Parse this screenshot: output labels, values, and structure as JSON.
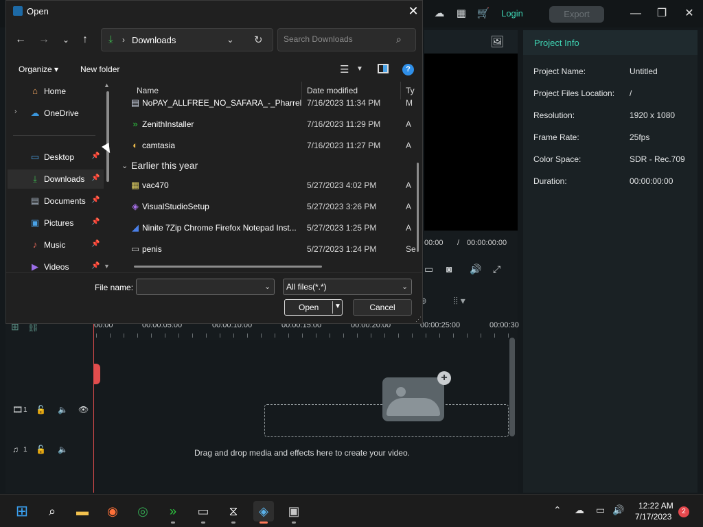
{
  "editor": {
    "login_label": "Login",
    "export_label": "Export",
    "project_panel": {
      "tab": "Project Info",
      "rows": [
        {
          "label": "Project Name:",
          "value": "Untitled"
        },
        {
          "label": "Project Files Location:",
          "value": "/"
        },
        {
          "label": "Resolution:",
          "value": "1920 x 1080"
        },
        {
          "label": "Frame Rate:",
          "value": "25fps"
        },
        {
          "label": "Color Space:",
          "value": "SDR - Rec.709"
        },
        {
          "label": "Duration:",
          "value": "00:00:00:00"
        }
      ]
    },
    "preview": {
      "time_current": "00:00",
      "time_sep": "/",
      "time_total": "00:00:00:00"
    },
    "timeline": {
      "ruler_labels": [
        "00:00",
        "00:00:05:00",
        "00:00:10:00",
        "00:00:15:00",
        "00:00:20:00",
        "00:00:25:00",
        "00:00:30"
      ],
      "drop_text": "Drag and drop media and effects here to create your video.",
      "video_track_num": "1",
      "audio_track_num": "1"
    }
  },
  "dialog": {
    "title": "Open",
    "address": "Downloads",
    "search_placeholder": "Search Downloads",
    "organize": "Organize",
    "new_folder": "New folder",
    "nav_items": [
      {
        "label": "Home",
        "icon": "home-icon",
        "pinned": false
      },
      {
        "label": "OneDrive",
        "icon": "cloud-icon",
        "pinned": false
      },
      {
        "label": "Desktop",
        "icon": "desktop-icon",
        "pinned": true
      },
      {
        "label": "Downloads",
        "icon": "download-icon",
        "pinned": true
      },
      {
        "label": "Documents",
        "icon": "document-icon",
        "pinned": true
      },
      {
        "label": "Pictures",
        "icon": "pictures-icon",
        "pinned": true
      },
      {
        "label": "Music",
        "icon": "music-icon",
        "pinned": true
      },
      {
        "label": "Videos",
        "icon": "videos-icon",
        "pinned": true
      }
    ],
    "columns": {
      "name": "Name",
      "date": "Date modified",
      "type": "Ty"
    },
    "files_recent": [
      {
        "name": "NoPAY_ALLFREE_NO_SAFARA_-_Pharrel_...",
        "date": "7/16/2023 11:34 PM",
        "type": "M",
        "icon": "media-file-icon"
      },
      {
        "name": "ZenithInstaller",
        "date": "7/16/2023 11:29 PM",
        "type": "A",
        "icon": "installer-icon"
      },
      {
        "name": "camtasia",
        "date": "7/16/2023 11:27 PM",
        "type": "A",
        "icon": "camtasia-icon"
      }
    ],
    "group_header": "Earlier this year",
    "files_earlier": [
      {
        "name": "vac470",
        "date": "5/27/2023 4:02 PM",
        "type": "A",
        "icon": "app-icon"
      },
      {
        "name": "VisualStudioSetup",
        "date": "5/27/2023 3:26 PM",
        "type": "A",
        "icon": "visual-studio-icon"
      },
      {
        "name": "Ninite 7Zip Chrome Firefox Notepad Inst...",
        "date": "5/27/2023 1:25 PM",
        "type": "A",
        "icon": "ninite-icon"
      },
      {
        "name": "penis",
        "date": "5/27/2023 1:24 PM",
        "type": "Se",
        "icon": "settings-file-icon"
      }
    ],
    "filename_label": "File name:",
    "filename_value": "",
    "filetype_value": "All files(*.*)",
    "open_label": "Open",
    "cancel_label": "Cancel"
  },
  "taskbar": {
    "apps": [
      "start-icon",
      "search-icon",
      "file-explorer-icon",
      "firefox-icon",
      "chrome-icon",
      "zenith-icon",
      "terminal-icon",
      "capcut-icon",
      "editor-icon",
      "installer-app-icon"
    ],
    "time": "12:22 AM",
    "date": "7/17/2023",
    "notifications": "2"
  }
}
